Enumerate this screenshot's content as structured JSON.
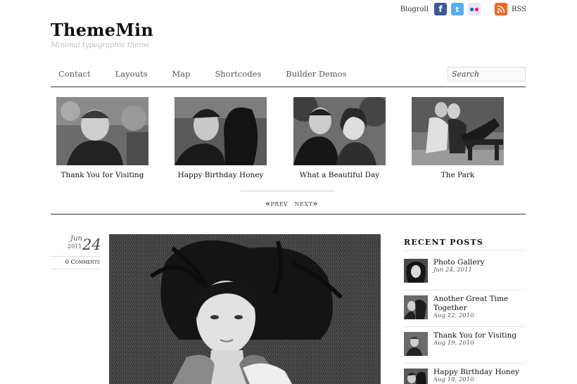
{
  "header": {
    "site_title": "ThemeMin",
    "tagline": "Minimal typographic theme",
    "blogroll_label": "Blogroll",
    "rss_label": "RSS",
    "social_icons": [
      "facebook-icon",
      "twitter-icon",
      "flickr-icon",
      "rss-icon"
    ]
  },
  "nav": {
    "items": [
      "Contact",
      "Layouts",
      "Map",
      "Shortcodes",
      "Builder Demos"
    ],
    "search_placeholder": "Search"
  },
  "slider": {
    "slides": [
      {
        "caption": "Thank You for Visiting"
      },
      {
        "caption": "Happy Birthday Honey"
      },
      {
        "caption": "What a Beautiful Day"
      },
      {
        "caption": "The Park"
      }
    ],
    "prev_label": "PREV",
    "next_label": "NEXT"
  },
  "post": {
    "month": "Jun",
    "year": "2011",
    "day": "24",
    "comments": "0 Comments"
  },
  "sidebar": {
    "recent_title": "RECENT POSTS",
    "recent_posts": [
      {
        "title": "Photo Gallery",
        "date": "Jun 24, 2011"
      },
      {
        "title": "Another Great Time Together",
        "date": "Aug 22, 2010"
      },
      {
        "title": "Thank You for Visiting",
        "date": "Aug 19, 2010"
      },
      {
        "title": "Happy Birthday Honey",
        "date": "Aug 18, 2010"
      }
    ]
  },
  "colors": {
    "text": "#111111",
    "muted": "#555555",
    "rule": "#333333",
    "facebook": "#3b5998",
    "twitter": "#55acee",
    "rss": "#f26522"
  }
}
